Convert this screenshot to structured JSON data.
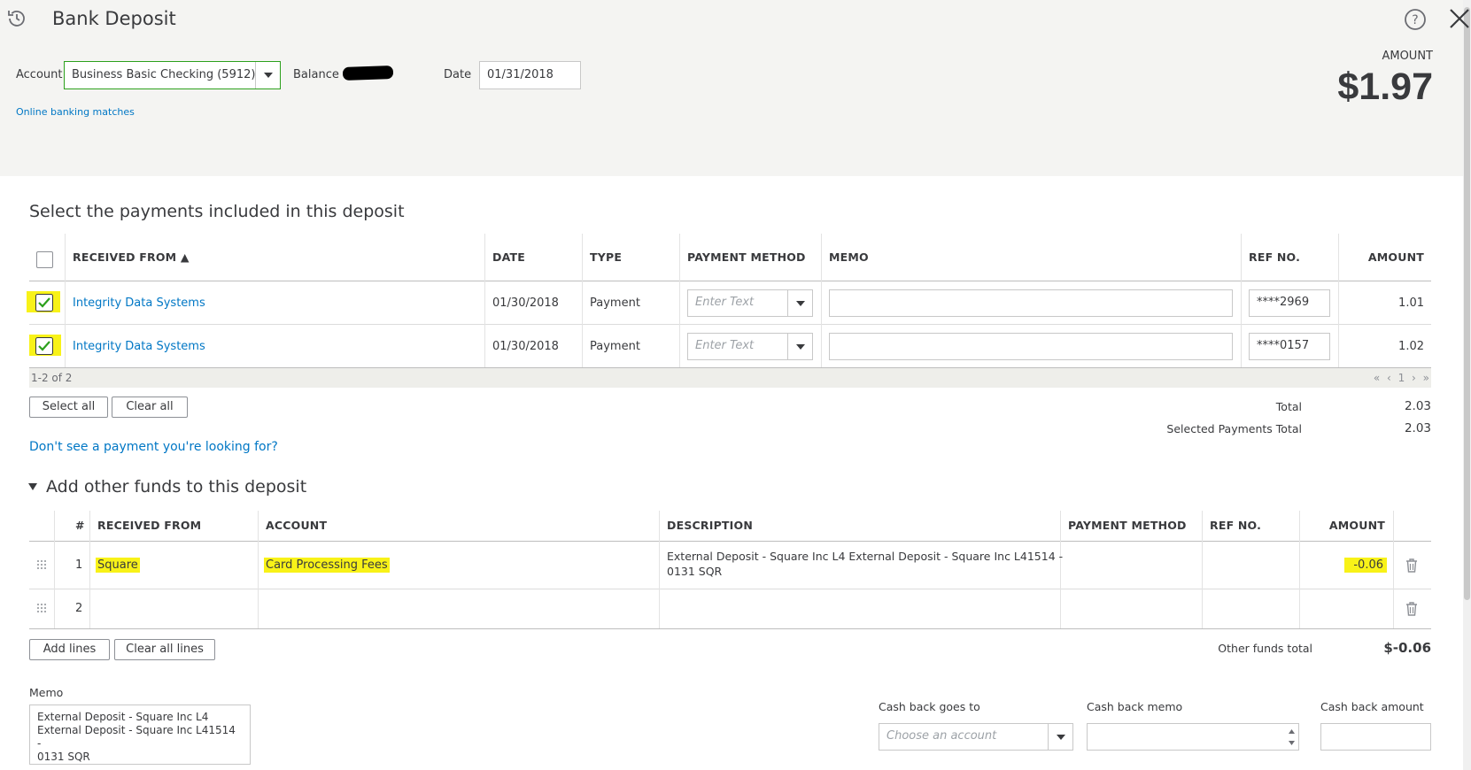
{
  "header": {
    "title": "Bank Deposit",
    "account_label": "Account",
    "account_value": "Business Basic Checking (5912)",
    "balance_label": "Balance $",
    "date_label": "Date",
    "date_value": "01/31/2018",
    "online_banking_link": "Online banking matches",
    "amount_label": "AMOUNT",
    "amount_value": "$1.97"
  },
  "payments": {
    "heading": "Select the payments included in this deposit",
    "columns": [
      "RECEIVED FROM ▲",
      "DATE",
      "TYPE",
      "PAYMENT METHOD",
      "MEMO",
      "REF NO.",
      "AMOUNT"
    ],
    "rows": [
      {
        "received_from": "Integrity Data Systems",
        "date": "01/30/2018",
        "type": "Payment",
        "payment_method_placeholder": "Enter Text",
        "memo": "",
        "ref_no": "****2969",
        "amount": "1.01",
        "checked": true
      },
      {
        "received_from": "Integrity Data Systems",
        "date": "01/30/2018",
        "type": "Payment",
        "payment_method_placeholder": "Enter Text",
        "memo": "",
        "ref_no": "****0157",
        "amount": "1.02",
        "checked": true
      }
    ],
    "pagination_summary": "1-2 of 2",
    "pagination_nav": "« ‹ 1 › »",
    "select_all_label": "Select all",
    "clear_all_label": "Clear all",
    "total_label": "Total",
    "total_value": "2.03",
    "selected_total_label": "Selected Payments Total",
    "selected_total_value": "2.03",
    "missing_payment_link": "Don't see a payment you're looking for?"
  },
  "other_funds": {
    "heading": "Add other funds to this deposit",
    "columns": [
      "#",
      "RECEIVED FROM",
      "ACCOUNT",
      "DESCRIPTION",
      "PAYMENT METHOD",
      "REF NO.",
      "AMOUNT"
    ],
    "rows": [
      {
        "num": "1",
        "received_from": "Square",
        "account": "Card Processing Fees",
        "description_line1": "External Deposit - Square Inc L4 External Deposit - Square Inc L41514 -",
        "description_line2": "0131 SQR",
        "payment_method": "",
        "ref_no": "",
        "amount": "-0.06"
      },
      {
        "num": "2",
        "received_from": "",
        "account": "",
        "description_line1": "",
        "description_line2": "",
        "payment_method": "",
        "ref_no": "",
        "amount": ""
      }
    ],
    "add_lines_label": "Add lines",
    "clear_all_lines_label": "Clear all lines",
    "total_label": "Other funds total",
    "total_value": "$-0.06"
  },
  "footer": {
    "memo_label": "Memo",
    "memo_line1": "External Deposit - Square Inc L4",
    "memo_line2": "External Deposit - Square Inc L41514 -",
    "memo_line3": "0131 SQR",
    "cash_back_goes_to_label": "Cash back goes to",
    "cash_back_goes_to_placeholder": "Choose an account",
    "cash_back_memo_label": "Cash back memo",
    "cash_back_amount_label": "Cash back amount"
  },
  "colors": {
    "link": "#0077c5",
    "highlight": "#f8f218",
    "header_bg": "#f4f4f2",
    "account_border": "#2ca01c"
  },
  "icons": [
    "history-icon",
    "help-icon",
    "close-icon",
    "sort-up-icon",
    "checkbox-checked-icon",
    "dropdown-arrow-icon",
    "grip-icon",
    "trash-icon",
    "collapse-triangle-icon"
  ]
}
